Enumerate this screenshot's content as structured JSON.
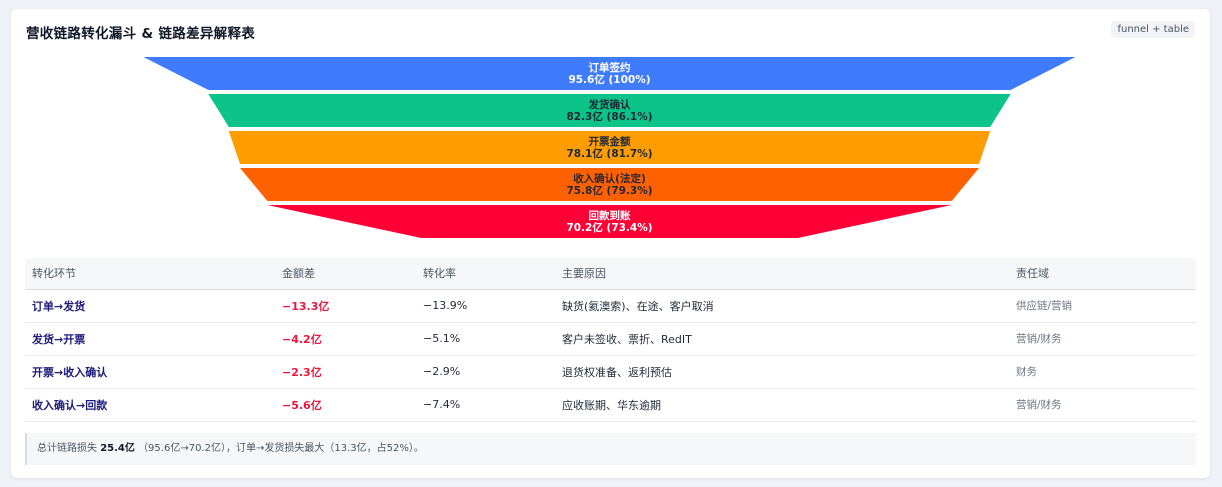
{
  "header": {
    "title": "营收链路转化漏斗 & 链路差异解释表",
    "badge": "funnel + table"
  },
  "chart_data": {
    "type": "funnel",
    "unit": "亿",
    "stages": [
      {
        "name": "订单签约",
        "value": 95.6,
        "pct": 100,
        "label": "95.6亿 (100%)",
        "color": "#3f7bfd"
      },
      {
        "name": "发货确认",
        "value": 82.3,
        "pct": 86.1,
        "label": "82.3亿 (86.1%)",
        "color": "#0cc487"
      },
      {
        "name": "开票金额",
        "value": 78.1,
        "pct": 81.7,
        "label": "78.1亿 (81.7%)",
        "color": "#ff9c00"
      },
      {
        "name": "收入确认(法定)",
        "value": 75.8,
        "pct": 79.3,
        "label": "75.8亿 (79.3%)",
        "color": "#ff6000"
      },
      {
        "name": "回款到账",
        "value": 70.2,
        "pct": 73.4,
        "label": "70.2亿 (73.4%)",
        "color": "#ff0036"
      }
    ]
  },
  "table": {
    "headers": [
      "转化环节",
      "金额差",
      "转化率",
      "主要原因",
      "责任域"
    ],
    "rows": [
      {
        "stage": "订单→发货",
        "diff": "−13.3亿",
        "rate": "−13.9%",
        "reason": "缺货(氦澳索)、在途、客户取消",
        "owner": "供应链/营销"
      },
      {
        "stage": "发货→开票",
        "diff": "−4.2亿",
        "rate": "−5.1%",
        "reason": "客户未签收、票折、RedIT",
        "owner": "营销/财务"
      },
      {
        "stage": "开票→收入确认",
        "diff": "−2.3亿",
        "rate": "−2.9%",
        "reason": "退货权准备、返利预估",
        "owner": "财务"
      },
      {
        "stage": "收入确认→回款",
        "diff": "−5.6亿",
        "rate": "−7.4%",
        "reason": "应收账期、华东逾期",
        "owner": "营销/财务"
      }
    ]
  },
  "note": {
    "prefix": "总计链路损失",
    "total": "25.4亿",
    "detail": "（95.6亿→70.2亿），订单→发货损失最大（13.3亿，占52%）。"
  }
}
